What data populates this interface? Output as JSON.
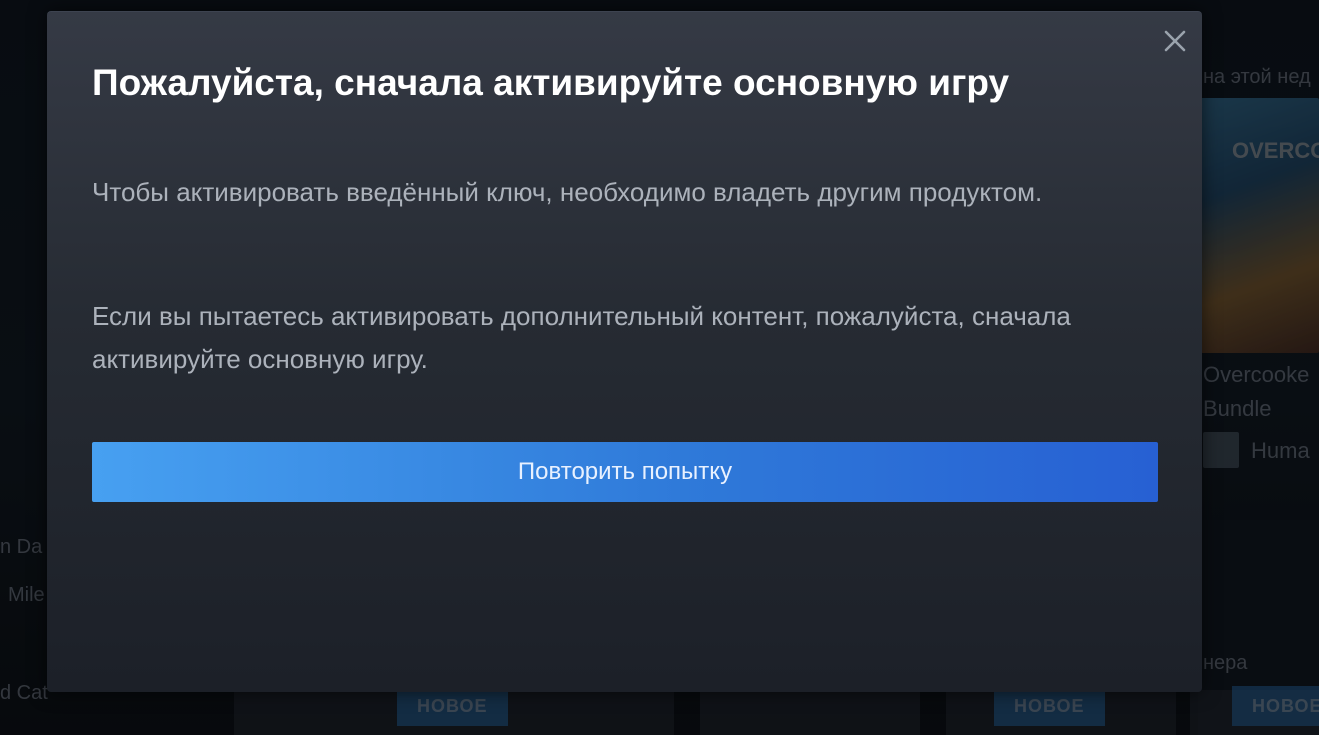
{
  "background": {
    "right_heading_partial": "на этой нед",
    "game_title_line1": "Overcooke",
    "game_title_line2": "Bundle",
    "publisher_partial": "Huma",
    "left_item_1": "n Da",
    "left_item_2": "Mile",
    "left_item_3": "d Cat",
    "right_section_partial": "нера",
    "badges": [
      "НОВОЕ",
      "НОВОЕ",
      "НОВОЕ"
    ],
    "art_logo": "OVERCOO"
  },
  "dialog": {
    "title": "Пожалуйста, сначала активируйте основную игру",
    "paragraph_1": "Чтобы активировать введённый ключ, необходимо владеть другим продуктом.",
    "paragraph_2": "Если вы пытаетесь активировать дополнительный контент, пожалуйста, сначала активируйте основную игру.",
    "retry_button_label": "Повторить попытку",
    "close_icon": "close-icon"
  }
}
